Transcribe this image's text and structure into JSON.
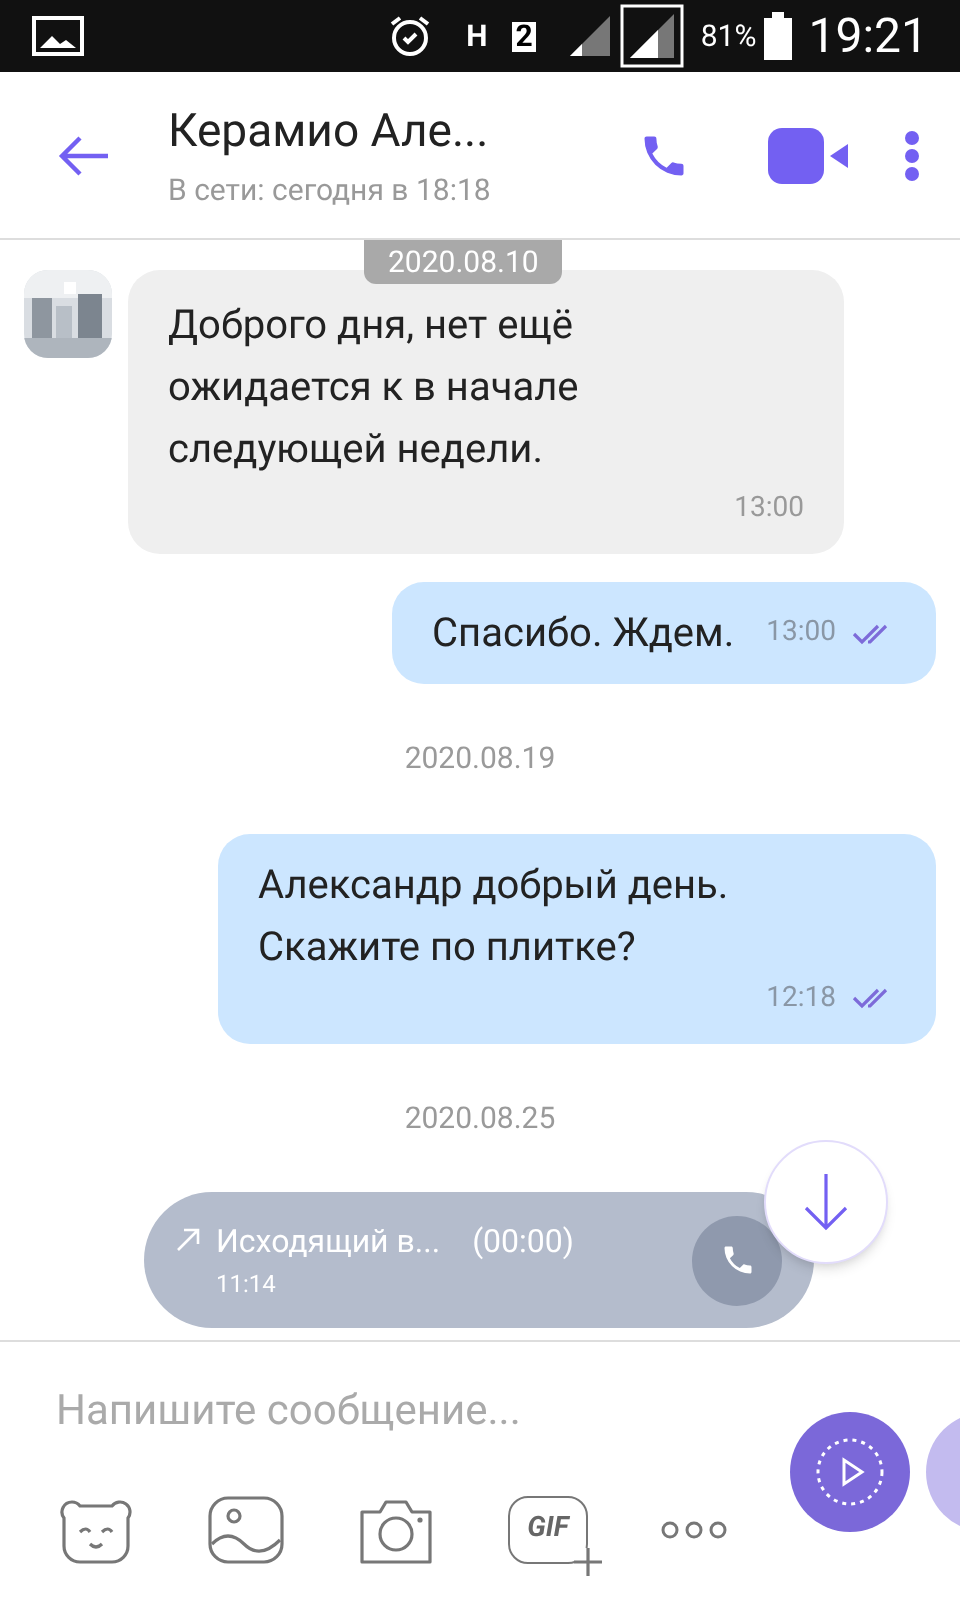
{
  "status_bar": {
    "network_type": "H",
    "sim": "2",
    "battery": "81%",
    "time": "19:21"
  },
  "header": {
    "title": "Керамио Але...",
    "subtitle": "В сети: сегодня в 18:18"
  },
  "sticky_date": "2020.08.10",
  "messages": [
    {
      "kind": "incoming",
      "text": "Доброго дня, нет ещё ожидается к в начале следующей недели.",
      "time": "13:00"
    },
    {
      "kind": "outgoing",
      "text": "Спасибо. Ждем.",
      "time": "13:00",
      "read": true
    },
    {
      "kind": "date",
      "text": "2020.08.19"
    },
    {
      "kind": "outgoing",
      "text": "Александр добрый день. Скажите по плитке?",
      "time": "12:18",
      "read": true
    },
    {
      "kind": "date",
      "text": "2020.08.25"
    },
    {
      "kind": "call",
      "text": "Исходящий в...",
      "duration": "(00:00)",
      "time": "11:14"
    }
  ],
  "composer": {
    "placeholder": "Напишите сообщение...",
    "gif_label": "GIF"
  }
}
